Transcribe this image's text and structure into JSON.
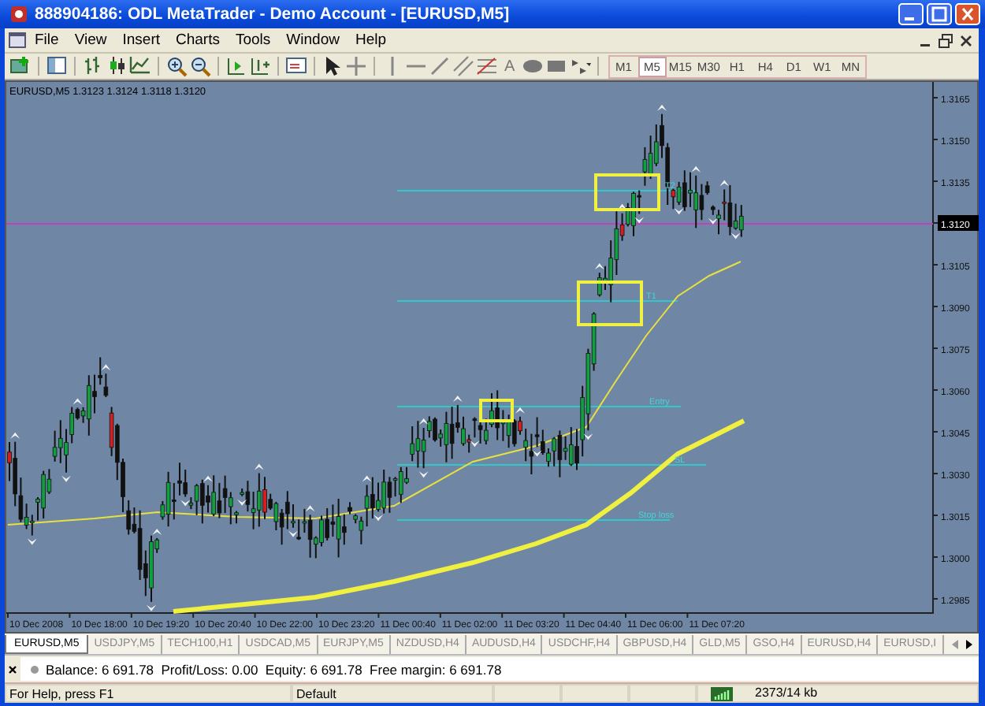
{
  "window": {
    "title": "888904186: ODL MetaTrader - Demo Account - [EURUSD,M5]"
  },
  "menu": [
    "File",
    "View",
    "Insert",
    "Charts",
    "Tools",
    "Window",
    "Help"
  ],
  "toolbar": {
    "text_tool": "A"
  },
  "timeframes": [
    {
      "label": "M1",
      "selected": false
    },
    {
      "label": "M5",
      "selected": true
    },
    {
      "label": "M15",
      "selected": false
    },
    {
      "label": "M30",
      "selected": false
    },
    {
      "label": "H1",
      "selected": false
    },
    {
      "label": "H4",
      "selected": false
    },
    {
      "label": "D1",
      "selected": false
    },
    {
      "label": "W1",
      "selected": false
    },
    {
      "label": "MN",
      "selected": false
    }
  ],
  "chart": {
    "header": "EURUSD,M5  1.3123 1.3124 1.3118 1.3120",
    "price_labels": [
      {
        "label": "1.3165",
        "highlighted": false
      },
      {
        "label": "1.3150",
        "highlighted": false
      },
      {
        "label": "1.3135",
        "highlighted": false
      },
      {
        "label": "1.3120",
        "highlighted": true
      },
      {
        "label": "1.3105",
        "highlighted": false
      },
      {
        "label": "1.3090",
        "highlighted": false
      },
      {
        "label": "1.3075",
        "highlighted": false
      },
      {
        "label": "1.3060",
        "highlighted": false
      },
      {
        "label": "1.3045",
        "highlighted": false
      },
      {
        "label": "1.3030",
        "highlighted": false
      },
      {
        "label": "1.3015",
        "highlighted": false
      },
      {
        "label": "1.3000",
        "highlighted": false
      },
      {
        "label": "1.2985",
        "highlighted": false
      }
    ],
    "time_labels": [
      "10 Dec 2008",
      "10 Dec 18:00",
      "10 Dec 19:20",
      "10 Dec 20:40",
      "10 Dec 22:00",
      "10 Dec 23:20",
      "11 Dec 00:40",
      "11 Dec 02:00",
      "11 Dec 03:20",
      "11 Dec 04:40",
      "11 Dec 06:00",
      "11 Dec 07:20"
    ],
    "level_lines": [
      {
        "label": "T2"
      },
      {
        "label": "T1"
      },
      {
        "label": "Entry"
      },
      {
        "label": "SL"
      },
      {
        "label": "Stop loss"
      }
    ]
  },
  "chart_tabs": [
    {
      "label": "EURUSD,M5",
      "selected": true
    },
    {
      "label": "USDJPY,M5",
      "selected": false
    },
    {
      "label": "TECH100,H1",
      "selected": false
    },
    {
      "label": "USDCAD,M5",
      "selected": false
    },
    {
      "label": "EURJPY,M5",
      "selected": false
    },
    {
      "label": "NZDUSD,H4",
      "selected": false
    },
    {
      "label": "AUDUSD,H4",
      "selected": false
    },
    {
      "label": "USDCHF,H4",
      "selected": false
    },
    {
      "label": "GBPUSD,H4",
      "selected": false
    },
    {
      "label": "GLD,M5",
      "selected": false
    },
    {
      "label": "GSO,H4",
      "selected": false
    },
    {
      "label": "EURUSD,H4",
      "selected": false
    },
    {
      "label": "EURUSD,I",
      "selected": false
    }
  ],
  "terminal": {
    "summary": "Balance: 6 691.78  Profit/Loss: 0.00  Equity: 6 691.78  Free margin: 6 691.78"
  },
  "status_bar": {
    "help": "For Help, press F1",
    "profile": "Default",
    "traffic": "2373/14 kb"
  }
}
